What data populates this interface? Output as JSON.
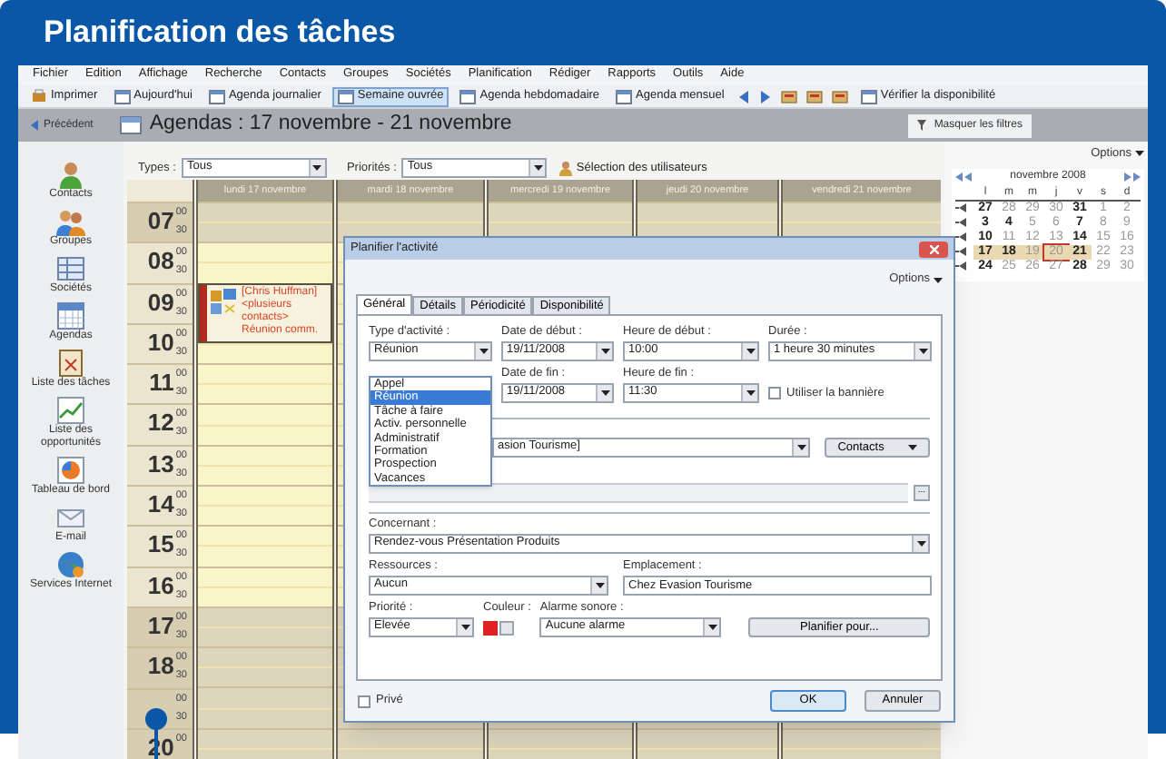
{
  "banner": {
    "title": "Planification des tâches"
  },
  "menu": [
    "Fichier",
    "Edition",
    "Affichage",
    "Recherche",
    "Contacts",
    "Groupes",
    "Sociétés",
    "Planification",
    "Rédiger",
    "Rapports",
    "Outils",
    "Aide"
  ],
  "toolbar": [
    {
      "kind": "button",
      "label": "Imprimer",
      "selected": false
    },
    {
      "kind": "button",
      "label": "Aujourd'hui",
      "selected": false
    },
    {
      "kind": "button",
      "label": "Agenda journalier",
      "selected": false
    },
    {
      "kind": "button",
      "label": "Semaine ouvrée",
      "selected": true
    },
    {
      "kind": "button",
      "label": "Agenda hebdomadaire",
      "selected": false
    },
    {
      "kind": "button",
      "label": "Agenda mensuel",
      "selected": false
    },
    {
      "kind": "back",
      "selected": false
    },
    {
      "kind": "forward",
      "selected": false
    },
    {
      "kind": "tool",
      "selected": false
    },
    {
      "kind": "tool",
      "selected": false
    },
    {
      "kind": "tool",
      "selected": false
    },
    {
      "kind": "button",
      "label": "Vérifier la disponibilité",
      "selected": false
    }
  ],
  "nav": {
    "back": "Précédent",
    "title": "Agendas : 17 novembre - 21 novembre",
    "filters": "Masquer les filtres"
  },
  "sidebar": [
    "Contacts",
    "Groupes",
    "Sociétés",
    "Agendas",
    "Liste des tâches",
    "Liste des opportunités",
    "Tableau de bord",
    "E-mail",
    "Services Internet"
  ],
  "filters": {
    "types_label": "Types :",
    "types_value": "Tous",
    "priorities_label": "Priorités :",
    "priorities_value": "Tous",
    "users": "Sélection des utilisateurs"
  },
  "calendar": {
    "days": [
      {
        "label": "lundi 17 novembre",
        "events": [
          {
            "text": "[Chris Huffman] <plusieurs contacts> Réunion comm."
          }
        ]
      },
      {
        "label": "mardi 18 novembre"
      },
      {
        "label": "mercredi 19 novembre"
      },
      {
        "label": "jeudi 20 novembre"
      },
      {
        "label": "vendredi 21 novembre"
      }
    ],
    "hours": [
      {
        "hour": "07",
        "minutes": [
          "00",
          "30"
        ],
        "working": false
      },
      {
        "hour": "08",
        "minutes": [
          "00",
          "30"
        ],
        "working": true
      },
      {
        "hour": "09",
        "minutes": [
          "00",
          "30"
        ],
        "working": true
      },
      {
        "hour": "10",
        "minutes": [
          "00",
          "30"
        ],
        "working": true
      },
      {
        "hour": "11",
        "minutes": [
          "00",
          "30"
        ],
        "working": true
      },
      {
        "hour": "12",
        "minutes": [
          "00",
          "30"
        ],
        "working": true
      },
      {
        "hour": "13",
        "minutes": [
          "00",
          "30"
        ],
        "working": true
      },
      {
        "hour": "14",
        "minutes": [
          "00",
          "30"
        ],
        "working": true
      },
      {
        "hour": "15",
        "minutes": [
          "00",
          "30"
        ],
        "working": true
      },
      {
        "hour": "16",
        "minutes": [
          "00",
          "30"
        ],
        "working": true
      },
      {
        "hour": "17",
        "minutes": [
          "00",
          "30"
        ],
        "working": false
      },
      {
        "hour": "18",
        "minutes": [
          "00",
          "30"
        ],
        "working": false
      },
      {
        "minutes": [
          "00",
          "30"
        ],
        "working": false
      },
      {
        "hour": "20",
        "minutes": [
          "00"
        ],
        "working": false
      }
    ]
  },
  "mini_calendar": {
    "options": "Options",
    "month": "novembre 2008",
    "weekdays": [
      "l",
      "m",
      "m",
      "j",
      "v",
      "s",
      "d"
    ],
    "weeks": [
      [
        {
          "text": "27",
          "bold": true,
          "selected": false,
          "today": false
        },
        {
          "text": "28",
          "bold": false,
          "selected": false,
          "today": false
        },
        {
          "text": "29",
          "bold": false,
          "selected": false,
          "today": false
        },
        {
          "text": "30",
          "bold": false,
          "selected": false,
          "today": false
        },
        {
          "text": "31",
          "bold": true,
          "selected": false,
          "today": false
        },
        {
          "text": "1",
          "bold": false,
          "selected": false,
          "today": false
        },
        {
          "text": "2",
          "bold": false,
          "selected": false,
          "today": false
        }
      ],
      [
        {
          "text": "3",
          "bold": true,
          "selected": false,
          "today": false
        },
        {
          "text": "4",
          "bold": true,
          "selected": false,
          "today": false
        },
        {
          "text": "5",
          "bold": false,
          "selected": false,
          "today": false
        },
        {
          "text": "6",
          "bold": false,
          "selected": false,
          "today": false
        },
        {
          "text": "7",
          "bold": true,
          "selected": false,
          "today": false
        },
        {
          "text": "8",
          "bold": false,
          "selected": false,
          "today": false
        },
        {
          "text": "9",
          "bold": false,
          "selected": false,
          "today": false
        }
      ],
      [
        {
          "text": "10",
          "bold": true,
          "selected": false,
          "today": false
        },
        {
          "text": "11",
          "bold": false,
          "selected": false,
          "today": false
        },
        {
          "text": "12",
          "bold": false,
          "selected": false,
          "today": false
        },
        {
          "text": "13",
          "bold": false,
          "selected": false,
          "today": false
        },
        {
          "text": "14",
          "bold": true,
          "selected": false,
          "today": false
        },
        {
          "text": "15",
          "bold": false,
          "selected": false,
          "today": false
        },
        {
          "text": "16",
          "bold": false,
          "selected": false,
          "today": false
        }
      ],
      [
        {
          "text": "17",
          "bold": true,
          "selected": true,
          "today": false
        },
        {
          "text": "18",
          "bold": true,
          "selected": true,
          "today": false
        },
        {
          "text": "19",
          "bold": false,
          "selected": true,
          "today": false
        },
        {
          "text": "20",
          "bold": false,
          "selected": true,
          "today": true
        },
        {
          "text": "21",
          "bold": true,
          "selected": true,
          "today": false
        },
        {
          "text": "22",
          "bold": false,
          "selected": false,
          "today": false
        },
        {
          "text": "23",
          "bold": false,
          "selected": false,
          "today": false
        }
      ],
      [
        {
          "text": "24",
          "bold": true,
          "selected": false,
          "today": false
        },
        {
          "text": "25",
          "bold": false,
          "selected": false,
          "today": false
        },
        {
          "text": "26",
          "bold": false,
          "selected": false,
          "today": false
        },
        {
          "text": "27",
          "bold": false,
          "selected": false,
          "today": false
        },
        {
          "text": "28",
          "bold": true,
          "selected": false,
          "today": false
        },
        {
          "text": "29",
          "bold": false,
          "selected": false,
          "today": false
        },
        {
          "text": "30",
          "bold": false,
          "selected": false,
          "today": false
        }
      ]
    ]
  },
  "dialog": {
    "title": "Planifier l'activité",
    "options": "Options",
    "tabs": [
      {
        "label": "Général",
        "selected": true
      },
      {
        "label": "Détails",
        "selected": false
      },
      {
        "label": "Périodicité",
        "selected": false
      },
      {
        "label": "Disponibilité",
        "selected": false
      }
    ],
    "type_label": "Type d'activité :",
    "type_value": "Réunion",
    "type_options": [
      {
        "label": "Appel",
        "selected": false
      },
      {
        "label": "Réunion",
        "selected": true
      },
      {
        "label": "Tâche à faire",
        "selected": false
      },
      {
        "label": "Activ. personnelle",
        "selected": false
      },
      {
        "label": "Administratif",
        "selected": false
      },
      {
        "label": "Formation",
        "selected": false
      },
      {
        "label": "Prospection",
        "selected": false
      },
      {
        "label": "Vacances",
        "selected": false
      }
    ],
    "start_date_label": "Date de début :",
    "start_date": "19/11/2008",
    "start_time_label": "Heure de début :",
    "start_time": "10:00",
    "duration_label": "Durée :",
    "duration": "1 heure 30 minutes",
    "end_date_label": "Date de fin :",
    "end_date": "19/11/2008",
    "end_time_label": "Heure de fin :",
    "end_time": "11:30",
    "banner_checkbox": {
      "label": "Utiliser la bannière",
      "checked": false
    },
    "contact_value": "asion Tourisme]",
    "contacts_button": "Contacts",
    "more_button": "...",
    "concerning_label": "Concernant :",
    "concerning": "Rendez-vous Présentation Produits",
    "resources_label": "Ressources :",
    "resources": "Aucun",
    "location_label": "Emplacement :",
    "location": "Chez Evasion Tourisme",
    "priority_label": "Priorité :",
    "priority": "Elevée",
    "color_label": "Couleur :",
    "alarm_label": "Alarme sonore :",
    "alarm": "Aucune alarme",
    "schedule_button": "Planifier pour...",
    "private": {
      "label": "Privé",
      "checked": false
    },
    "ok": "OK",
    "cancel": "Annuler"
  }
}
